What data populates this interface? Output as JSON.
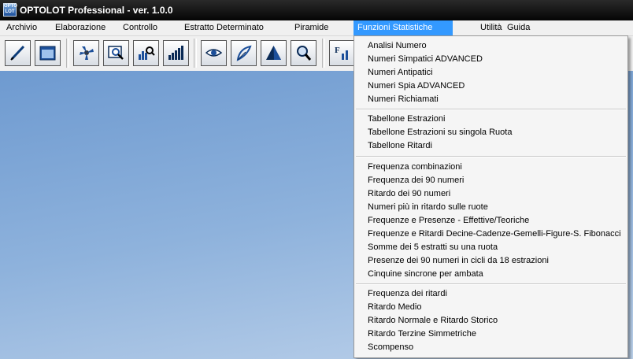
{
  "window": {
    "title": "OPTOLOT Professional - ver. 1.0.0",
    "icon": "optolot-app-icon",
    "icon_text": "OPTO LOT"
  },
  "menu": {
    "items": [
      {
        "label": "Archivio"
      },
      {
        "label": "Elaborazione"
      },
      {
        "label": "Controllo"
      },
      {
        "label": "Estratto Determinato"
      },
      {
        "label": "Piramide"
      },
      {
        "label": "Funzioni Statistiche",
        "active": true
      },
      {
        "label": "Utilità"
      },
      {
        "label": "Guida"
      }
    ]
  },
  "toolbar": {
    "buttons": [
      {
        "icon": "pen-icon"
      },
      {
        "icon": "window-icon"
      },
      {
        "icon": "fan-icon"
      },
      {
        "icon": "image-search-icon"
      },
      {
        "icon": "chart-search-icon"
      },
      {
        "icon": "bar-chart-icon"
      },
      {
        "icon": "eye-icon"
      },
      {
        "icon": "feather-icon"
      },
      {
        "icon": "pyramid-icon"
      },
      {
        "icon": "magnifier-icon"
      },
      {
        "icon": "frequency-chart-icon",
        "label": "F"
      }
    ]
  },
  "dropdown": {
    "groups": [
      {
        "items": [
          "Analisi Numero",
          "Numeri Simpatici ADVANCED",
          "Numeri Antipatici",
          "Numeri Spia ADVANCED",
          "Numeri Richiamati"
        ]
      },
      {
        "items": [
          "Tabellone Estrazioni",
          "Tabellone Estrazioni su singola Ruota",
          "Tabellone Ritardi"
        ]
      },
      {
        "items": [
          "Frequenza combinazioni",
          "Frequenza dei 90 numeri",
          "Ritardo dei 90 numeri",
          "Numeri più in ritardo sulle ruote",
          "Frequenze e Presenze - Effettive/Teoriche",
          "Frequenze e Ritardi Decine-Cadenze-Gemelli-Figure-S. Fibonacci",
          "Somme dei 5 estratti su una ruota",
          "Presenze dei 90 numeri in cicli da 18 estrazioni",
          "Cinquine sincrone per ambata"
        ]
      },
      {
        "items": [
          "Frequenza dei ritardi",
          "Ritardo Medio",
          "Ritardo Normale e Ritardo Storico",
          "Ritardo Terzine Simmetriche",
          "Scompenso"
        ]
      }
    ]
  },
  "colors": {
    "menu_highlight": "#3399ff",
    "desktop_top": "#6e9ad0",
    "desktop_bottom": "#bcd1ea",
    "titlebar": "#1a1a1a"
  }
}
